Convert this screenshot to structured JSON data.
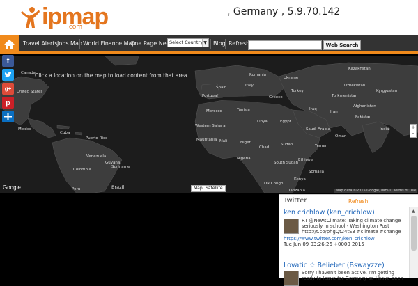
{
  "logo": {
    "word": "ipmap",
    "suffix": ".com"
  },
  "header": {
    "ip_info": ", Germany , 5.9.70.142"
  },
  "nav": {
    "links": [
      "Travel Alerts",
      "Jobs Map",
      "World Finance Map",
      "One Page News",
      "Blog",
      "Refresh"
    ],
    "country_select": "Select Country",
    "search_button": "Web Search"
  },
  "map": {
    "message": "Click a location on the map to load content from that area.",
    "labels": [
      "Kazakhstan",
      "Romania",
      "Uzbekistan",
      "Kyrgyzstan",
      "Ukraine",
      "Spain",
      "Italy",
      "Turkey",
      "Turkmenistan",
      "Portugal",
      "Greece",
      "Afghanistan",
      "Iraq",
      "Iran",
      "Pakistan",
      "Morocco",
      "Tunisia",
      "Libya",
      "Egypt",
      "Saudi Arabia",
      "India",
      "Western Sahara",
      "Mauritania",
      "Mali",
      "Niger",
      "Chad",
      "Sudan",
      "Yemen",
      "Oman",
      "Nigeria",
      "Ethiopia",
      "South Sudan",
      "Somalia",
      "Kenya",
      "Tanzania",
      "DR Congo",
      "Canada",
      "United States",
      "Mexico",
      "Cuba",
      "Puerto Rico",
      "Venezuela",
      "Colombia",
      "Guyana",
      "Suriname",
      "Peru",
      "Brazil"
    ],
    "type_buttons": [
      "Map",
      "Satellite"
    ],
    "google": "Google",
    "credit": "Map data ©2015 Google, INEGI",
    "terms": "Terms of Use",
    "zoom_in": "+",
    "zoom_out": "-"
  },
  "share": {
    "buttons": [
      "f",
      "t",
      "g+",
      "p",
      "share"
    ]
  },
  "twitter": {
    "title": "Twitter",
    "refresh": "Refresh",
    "tweets": [
      {
        "name": "ken crichlow (ken_crichlow)",
        "text": "RT @NewsClimate: Taking climate change seriously in school - Washington Post http://t.co/phgQt24tS3 #climate #change",
        "link": "https://www.twitter.com/ken_crichlow",
        "date": "Tue Jun 09 03:26:26 +0000 2015"
      },
      {
        "name": "Lovatic ☆ Belieber (Bswayzze)",
        "text": "Sorry I haven't been active. I'm getting ready to leave for Germany so I have been"
      }
    ]
  },
  "colors": {
    "accent": "#f08a1c",
    "nav_bg": "#333333",
    "link": "#1b63b8"
  }
}
